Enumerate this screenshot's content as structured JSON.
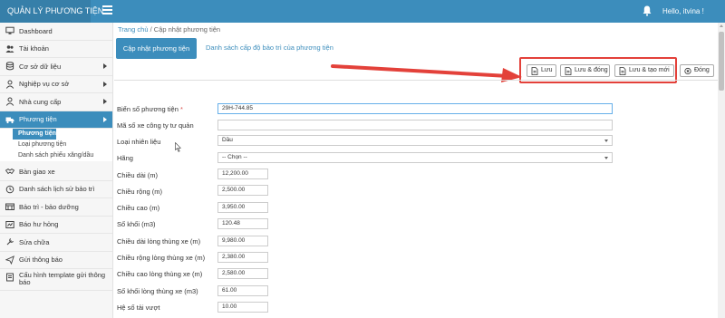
{
  "app": {
    "brand": "QUẢN LÝ PHƯƠNG TIỆN",
    "greeting": "Hello, itvina !",
    "accent_color": "#3c8dbc"
  },
  "sidebar": {
    "items": [
      {
        "label": "Dashboard",
        "icon": "monitor-icon",
        "has_caret": false
      },
      {
        "label": "Tài khoản",
        "icon": "users-icon",
        "has_caret": false
      },
      {
        "label": "Cơ sở dữ liệu",
        "icon": "database-icon",
        "has_caret": true
      },
      {
        "label": "Nghiệp vụ cơ sở",
        "icon": "user-icon",
        "has_caret": true
      },
      {
        "label": "Nhà cung cấp",
        "icon": "user-icon",
        "has_caret": true
      },
      {
        "label": "Phương tiện",
        "icon": "truck-icon",
        "has_caret": true,
        "active": true
      }
    ],
    "sub_items": [
      {
        "label": "Phương tiện",
        "active": true
      },
      {
        "label": "Loại phương tiện"
      },
      {
        "label": "Danh sách phiếu xăng/dầu"
      }
    ],
    "items_after": [
      {
        "label": "Bàn giao xe",
        "icon": "handshake-icon"
      },
      {
        "label": "Danh sách lịch sử bảo trì",
        "icon": "history-icon"
      },
      {
        "label": "Bảo trì - bảo dưỡng",
        "icon": "wrench-icon"
      },
      {
        "label": "Báo hư hỏng",
        "icon": "alert-icon"
      },
      {
        "label": "Sửa chữa",
        "icon": "tools-icon"
      },
      {
        "label": "Gửi thông báo",
        "icon": "paper-plane-icon"
      },
      {
        "label": "Cấu hình template gửi thông báo",
        "icon": "template-icon"
      }
    ]
  },
  "breadcrumb": {
    "home": "Trang chủ",
    "separator": "/",
    "current": "Cập nhật phương tiện"
  },
  "tabs": {
    "active": "Cập nhật phương tiện",
    "other": "Danh sách cấp độ bảo trì của phương tiện"
  },
  "toolbar": {
    "save": "Lưu",
    "save_close": "Lưu & đóng",
    "save_new": "Lưu & tạo mới",
    "close": "Đóng",
    "highlight_color": "#e3413a"
  },
  "form": {
    "fields": [
      {
        "label": "Biển số phương tiện",
        "required": "*",
        "value": "29H-744.85",
        "type": "text"
      },
      {
        "label": "Mã số xe công ty tư quản",
        "value": "",
        "type": "text"
      },
      {
        "label": "Loại nhiên liệu",
        "value": "Dầu",
        "type": "select"
      },
      {
        "label": "Hãng",
        "value": "-- Chọn --",
        "type": "select"
      },
      {
        "label": "Chiều dài (m)",
        "value": "12,200.00",
        "type": "text"
      },
      {
        "label": "Chiều rộng (m)",
        "value": "2,500.00",
        "type": "text"
      },
      {
        "label": "Chiều cao (m)",
        "value": "3,950.00",
        "type": "text"
      },
      {
        "label": "Số khối (m3)",
        "value": "120.48",
        "type": "text"
      },
      {
        "label": "Chiều dài lòng thùng xe (m)",
        "value": "9,980.00",
        "type": "text"
      },
      {
        "label": "Chiều rộng lòng thùng xe (m)",
        "value": "2,380.00",
        "type": "text"
      },
      {
        "label": "Chiều cao lòng thùng xe (m)",
        "value": "2,580.00",
        "type": "text"
      },
      {
        "label": "Số khối lòng thùng xe (m3)",
        "value": "61.00",
        "type": "text"
      },
      {
        "label": "Hệ số tải vượt",
        "value": "10.00",
        "type": "text"
      }
    ]
  }
}
